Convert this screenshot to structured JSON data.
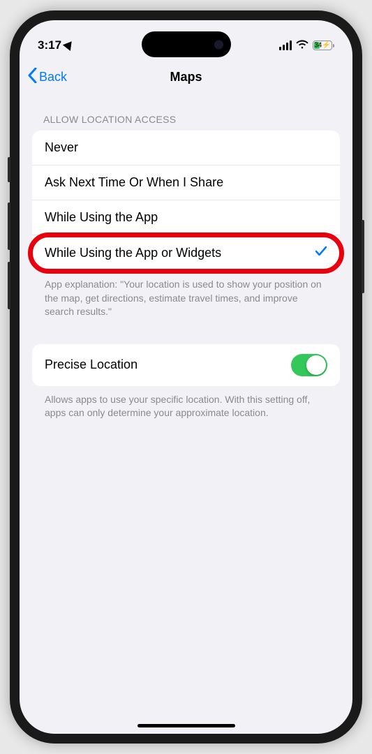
{
  "statusBar": {
    "time": "3:17",
    "batteryPercent": "34"
  },
  "nav": {
    "backLabel": "Back",
    "title": "Maps"
  },
  "sections": {
    "locationAccess": {
      "header": "ALLOW LOCATION ACCESS",
      "options": [
        {
          "label": "Never",
          "selected": false
        },
        {
          "label": "Ask Next Time Or When I Share",
          "selected": false
        },
        {
          "label": "While Using the App",
          "selected": false
        },
        {
          "label": "While Using the App or Widgets",
          "selected": true
        }
      ],
      "footer": "App explanation: \"Your location is used to show your position on the map, get directions, estimate travel times, and improve search results.\""
    },
    "precise": {
      "label": "Precise Location",
      "enabled": true,
      "footer": "Allows apps to use your specific location. With this setting off, apps can only determine your approximate location."
    }
  },
  "colors": {
    "accent": "#007aff",
    "toggleOn": "#34c759",
    "highlight": "#e8000d"
  }
}
